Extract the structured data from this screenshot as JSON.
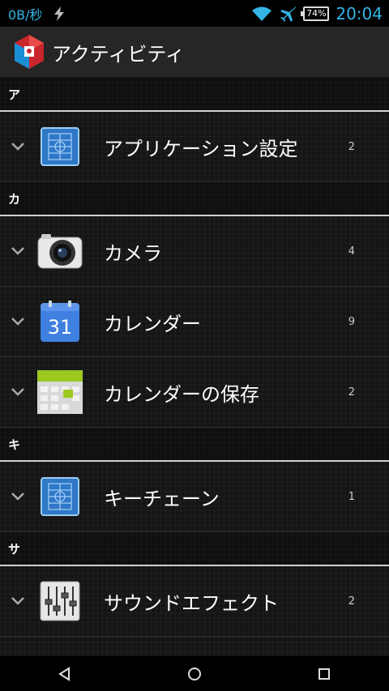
{
  "status_bar": {
    "net_speed": "0B/秒",
    "battery": "74%",
    "time": "20:04"
  },
  "action_bar": {
    "title": "アクティビティ"
  },
  "sections": [
    {
      "header": "ア",
      "items": [
        {
          "label": "アプリケーション設定",
          "count": "2",
          "icon": "blueprint-icon"
        }
      ]
    },
    {
      "header": "カ",
      "items": [
        {
          "label": "カメラ",
          "count": "4",
          "icon": "camera-icon"
        },
        {
          "label": "カレンダー",
          "count": "9",
          "icon": "calendar-icon",
          "icon_text": "31"
        },
        {
          "label": "カレンダーの保存",
          "count": "2",
          "icon": "calendar-storage-icon"
        }
      ]
    },
    {
      "header": "キ",
      "items": [
        {
          "label": "キーチェーン",
          "count": "1",
          "icon": "blueprint-icon"
        }
      ]
    },
    {
      "header": "サ",
      "items": [
        {
          "label": "サウンドエフェクト",
          "count": "2",
          "icon": "equalizer-icon"
        }
      ]
    }
  ],
  "colors": {
    "accent": "#33b5e5",
    "action_bar": "#262626",
    "calendar_blue": "#3f7fe0",
    "calendar_green": "#9cc820"
  }
}
